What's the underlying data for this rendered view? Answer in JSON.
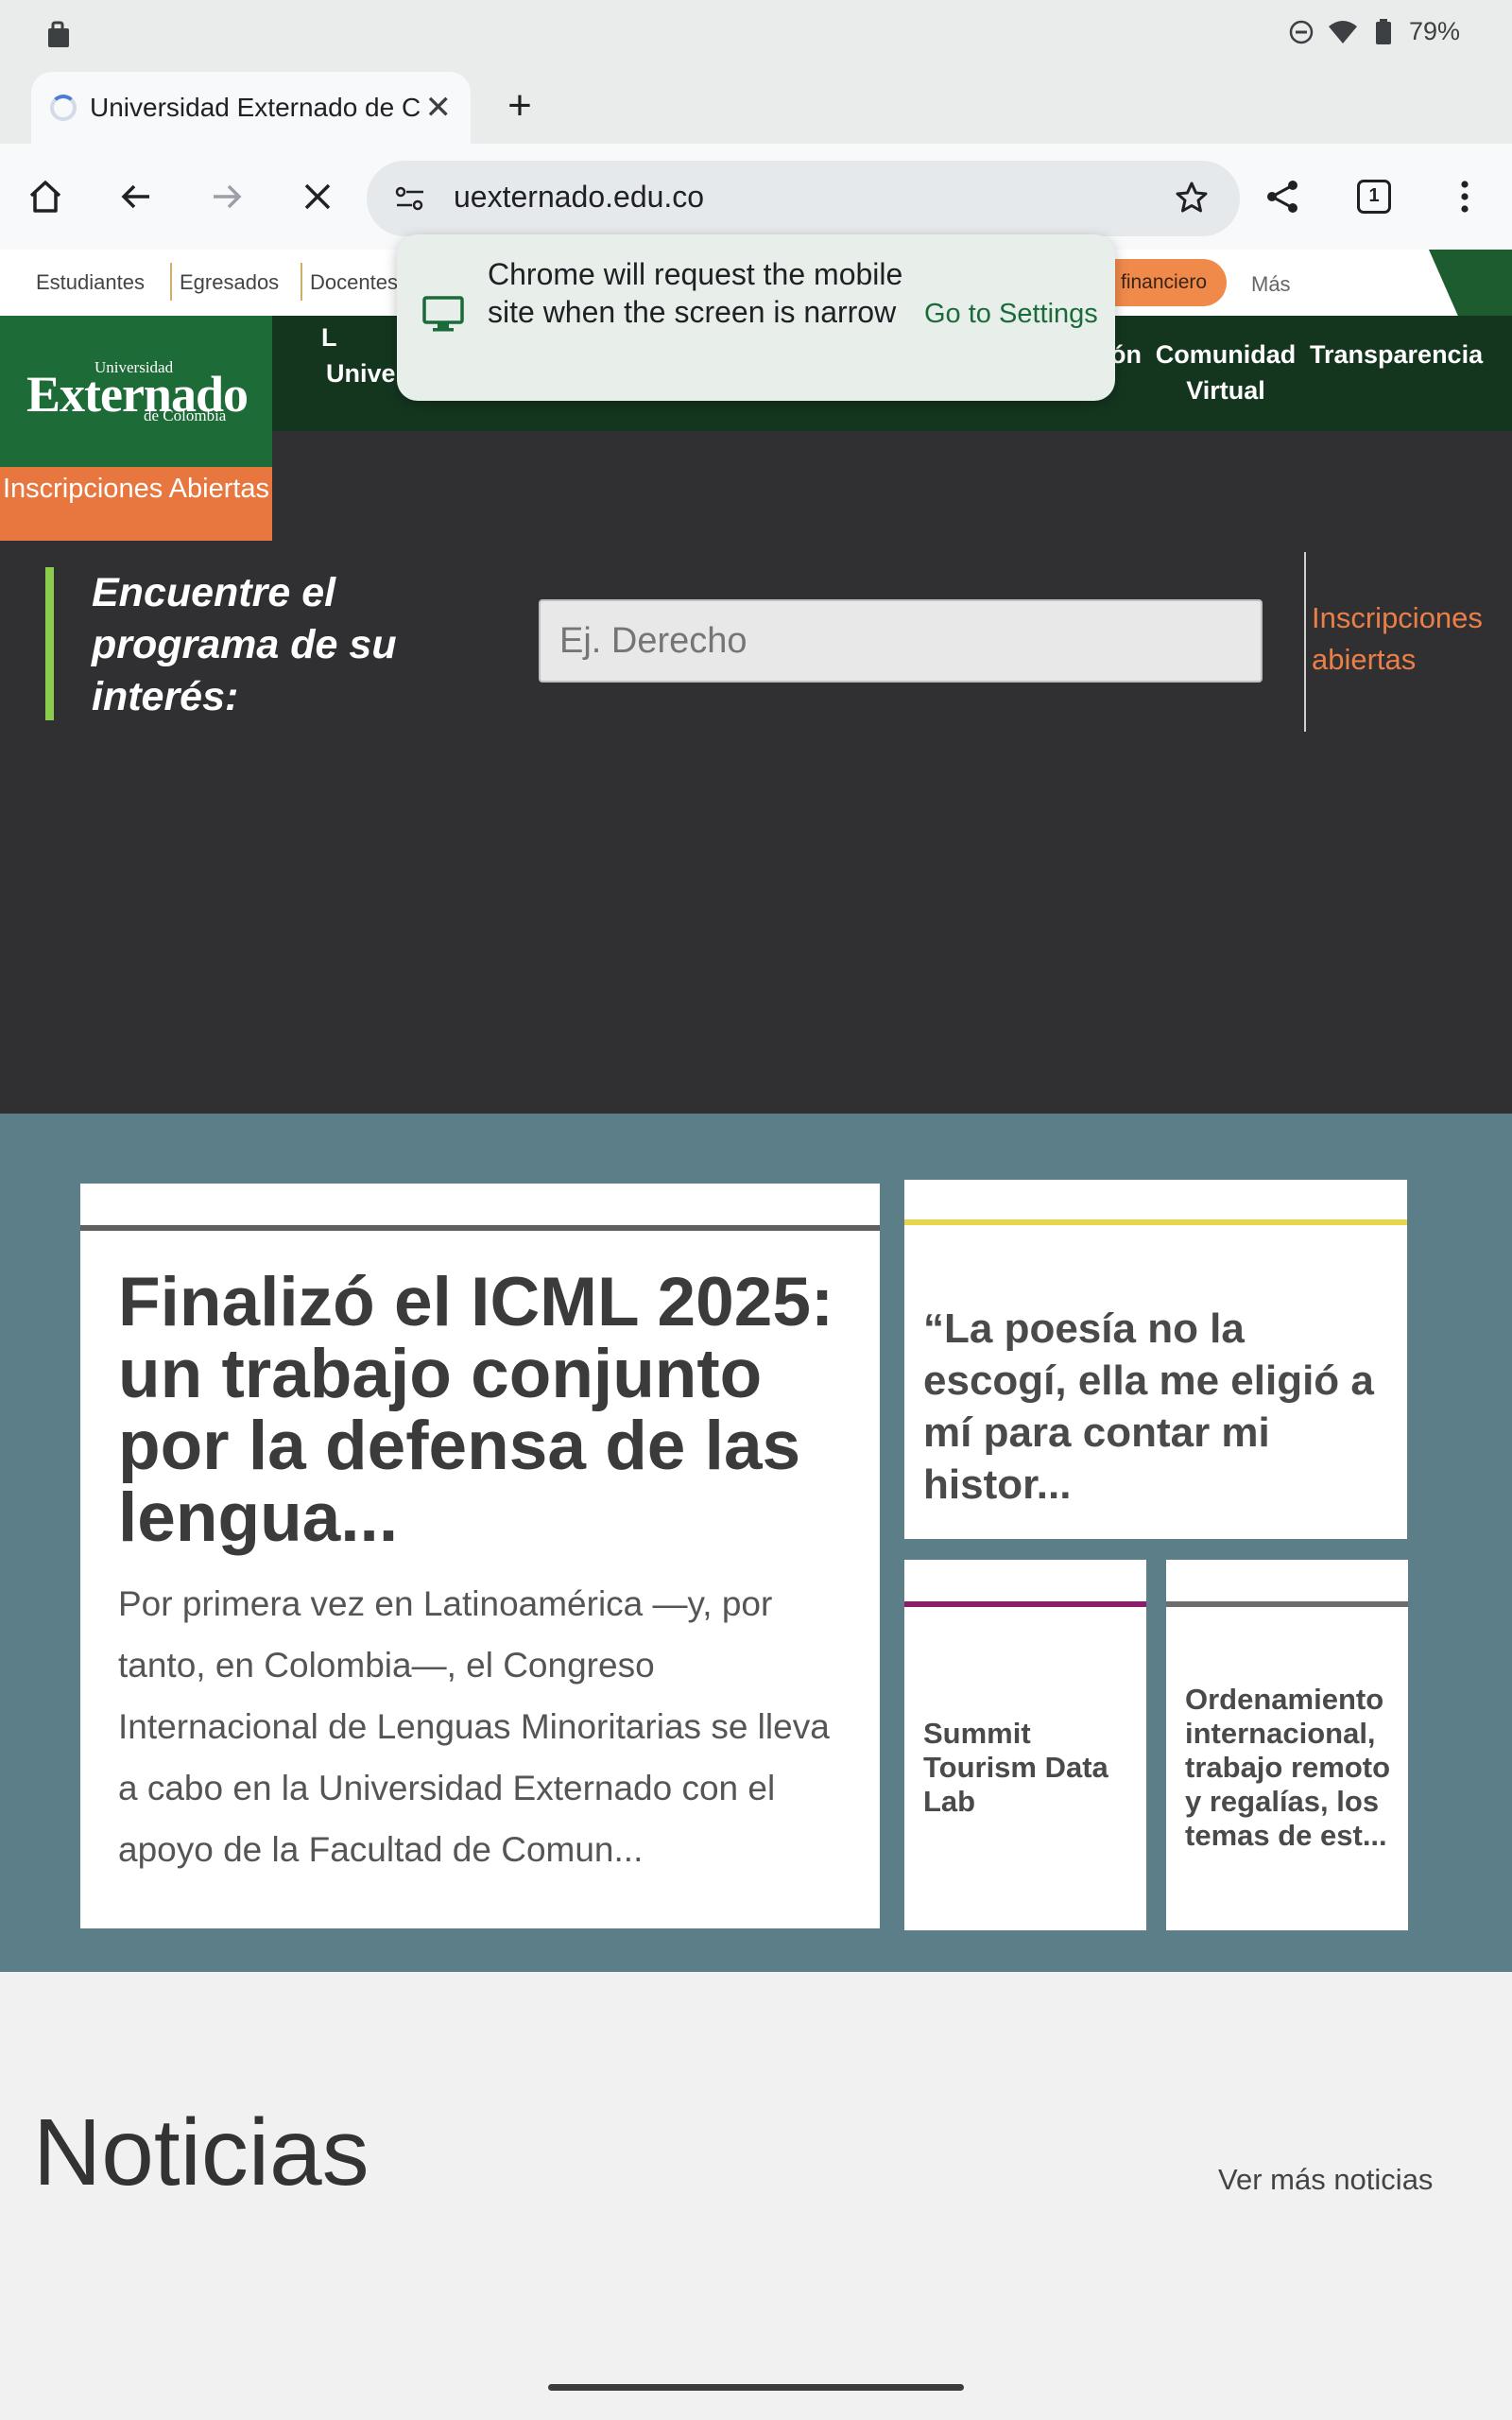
{
  "status_bar": {
    "battery": "79%"
  },
  "browser": {
    "tab_title": "Universidad Externado de Colombia",
    "new_tab": "+",
    "url": "uexternado.edu.co",
    "tab_count": "1"
  },
  "site": {
    "top_links": [
      "Estudiantes",
      "Egresados",
      "Docentes"
    ],
    "financiero": "financiero",
    "mas": "Más",
    "logo": {
      "small": "Universidad",
      "big": "Externado",
      "sub": "de Colombia"
    },
    "nav": {
      "left_partial_line1": "L",
      "left_partial_line2": "Univer",
      "partial_on": "ón",
      "comunidad": "Comunidad Virtual",
      "transparencia": "Transparencia"
    },
    "inscripciones_button": "Inscripciones Abiertas",
    "search": {
      "heading": "Encuentre el programa de su interés:",
      "placeholder": "Ej. Derecho",
      "side_link": "Inscripciones abiertas"
    },
    "featured": {
      "title": "Finalizó el ICML 2025: un trabajo conjunto por la defensa de las lengua...",
      "excerpt": "Por primera vez en Latinoamérica —y, por tanto, en Colombia—, el Congreso Internacional de Lenguas Minoritarias se lleva a cabo en la Universidad Externado con el apoyo de la Facultad de Comun..."
    },
    "quote_card": "“La poesía no la escogí, ella me eligió a mí para contar mi histor...",
    "small_cards": [
      {
        "title": "Summit Tourism Data Lab",
        "bar_color": "#8a1e6b"
      },
      {
        "title": "Ordenamiento internacional, trabajo remoto y regalías, los temas de est...",
        "bar_color": "#6d6d6d"
      }
    ],
    "noticias": {
      "title": "Noticias",
      "ver_mas": "Ver más noticias"
    }
  },
  "popup": {
    "message": "Chrome will request the mobile site when the screen is narrow",
    "action": "Go to Settings"
  },
  "colors": {
    "brand_green": "#1d6b37",
    "nav_dark_green": "#14361f",
    "accent_orange": "#e7773f",
    "news_band": "#5b7e88"
  }
}
